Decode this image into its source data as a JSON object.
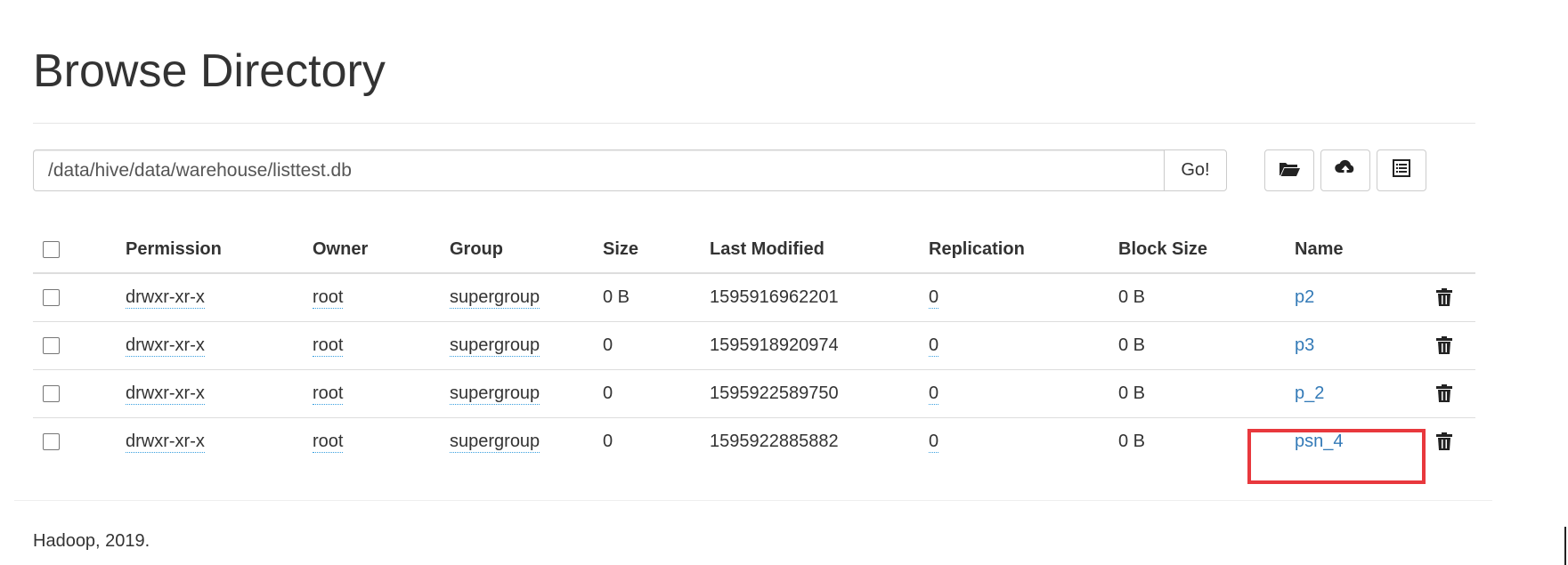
{
  "page": {
    "title": "Browse Directory"
  },
  "path_bar": {
    "value": "/data/hive/data/warehouse/listtest.db",
    "go_label": "Go!"
  },
  "toolbar": {
    "icons": [
      "folder-open-icon",
      "cloud-upload-icon",
      "list-icon"
    ]
  },
  "table": {
    "headers": [
      "Permission",
      "Owner",
      "Group",
      "Size",
      "Last Modified",
      "Replication",
      "Block Size",
      "Name"
    ],
    "rows": [
      {
        "permission": "drwxr-xr-x",
        "owner": "root",
        "group": "supergroup",
        "size": "0 B",
        "last_modified": "1595916962201",
        "replication": "0",
        "block_size": "0 B",
        "name": "p2"
      },
      {
        "permission": "drwxr-xr-x",
        "owner": "root",
        "group": "supergroup",
        "size": "0",
        "last_modified": "1595918920974",
        "replication": "0",
        "block_size": "0 B",
        "name": "p3"
      },
      {
        "permission": "drwxr-xr-x",
        "owner": "root",
        "group": "supergroup",
        "size": "0",
        "last_modified": "1595922589750",
        "replication": "0",
        "block_size": "0 B",
        "name": "p_2"
      },
      {
        "permission": "drwxr-xr-x",
        "owner": "root",
        "group": "supergroup",
        "size": "0",
        "last_modified": "1595922885882",
        "replication": "0",
        "block_size": "0 B",
        "name": "psn_4"
      }
    ],
    "highlighted_row": 3
  },
  "colors": {
    "link": "#337ab7",
    "highlight": "#e8383d",
    "text": "#333333"
  },
  "footer": {
    "text": "Hadoop, 2019."
  }
}
